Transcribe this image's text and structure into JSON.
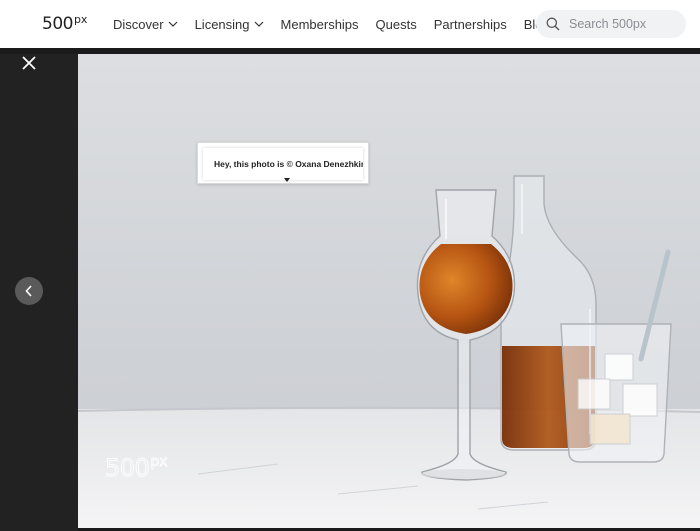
{
  "header": {
    "logo": {
      "main": "500",
      "sup": "px"
    },
    "nav": [
      {
        "label": "Discover",
        "has_dropdown": true
      },
      {
        "label": "Licensing",
        "has_dropdown": true
      },
      {
        "label": "Memberships",
        "has_dropdown": false
      },
      {
        "label": "Quests",
        "has_dropdown": false
      },
      {
        "label": "Partnerships",
        "has_dropdown": false
      },
      {
        "label": "Blog",
        "has_dropdown": false
      }
    ],
    "search": {
      "placeholder": "Search 500px",
      "value": "",
      "icon": "search-icon"
    }
  },
  "viewer": {
    "close_icon": "close-icon",
    "prev_icon": "chevron-left-icon",
    "tooltip_text": "Hey, this photo is © Oxana Denezhkina",
    "watermark": {
      "main": "500",
      "sup": "px"
    }
  },
  "colors": {
    "header_bg": "#ffffff",
    "viewer_bg": "#222222",
    "liquor": "#b85a16",
    "wall": "#d6d8dc"
  }
}
